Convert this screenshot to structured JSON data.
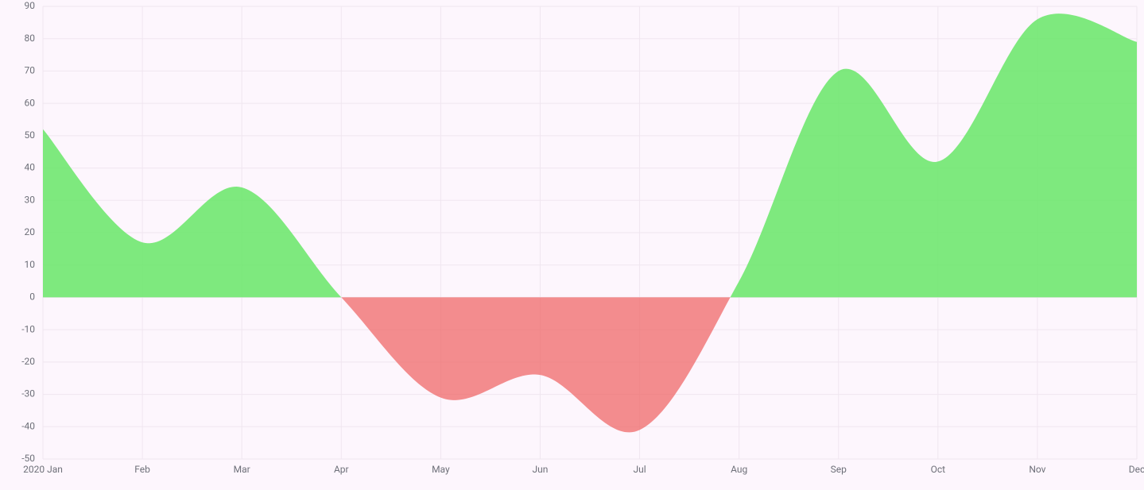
{
  "chart_data": {
    "type": "area",
    "x_labels": [
      "2020 Jan",
      "Feb",
      "Mar",
      "Apr",
      "May",
      "Jun",
      "Jul",
      "Aug",
      "Sep",
      "Oct",
      "Nov",
      "Dec"
    ],
    "values": [
      52,
      17,
      34,
      0,
      -31,
      -24,
      -41,
      5,
      70,
      42,
      86,
      79
    ],
    "ylim": [
      -50,
      90
    ],
    "y_ticks": [
      -50,
      -40,
      -30,
      -20,
      -10,
      0,
      10,
      20,
      30,
      40,
      50,
      60,
      70,
      80,
      90
    ],
    "title": "",
    "xlabel": "",
    "ylabel": "",
    "colors": {
      "positive": "#67e667",
      "negative": "#ef6868"
    },
    "grid": {
      "horizontal": true,
      "vertical": true
    },
    "smooth": true
  }
}
